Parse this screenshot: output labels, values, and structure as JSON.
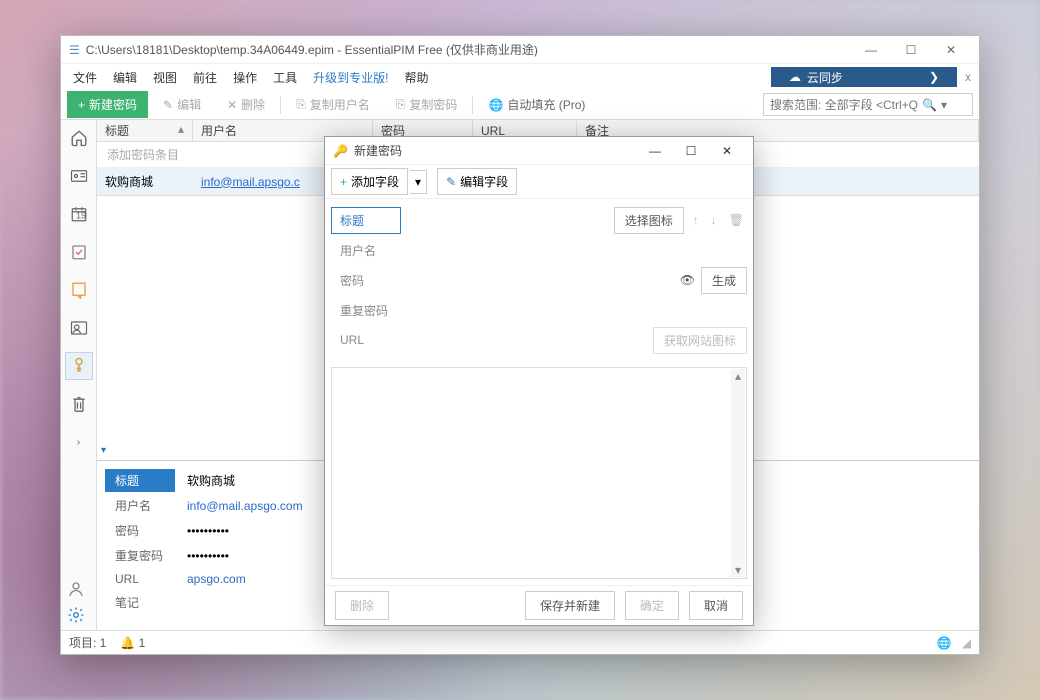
{
  "window": {
    "title": "C:\\Users\\18181\\Desktop\\temp.34A06449.epim - EssentialPIM Free (仅供非商业用途)"
  },
  "menu": {
    "file": "文件",
    "edit": "编辑",
    "view": "视图",
    "goto": "前往",
    "action": "操作",
    "tool": "工具",
    "upgrade": "升级到专业版!",
    "help": "帮助",
    "cloud": "云同步"
  },
  "toolbar": {
    "new": "新建密码",
    "edit": "编辑",
    "del": "删除",
    "copyuser": "复制用户名",
    "copypwd": "复制密码",
    "autofill": "自动填充 (Pro)",
    "search": "搜索范围: 全部字段  <Ctrl+Q"
  },
  "grid": {
    "cols": {
      "title": "标题",
      "user": "用户名",
      "pwd": "密码",
      "url": "URL",
      "note": "备注"
    },
    "addrow": "添加密码条目",
    "row": {
      "title": "软购商城",
      "user": "info@mail.apsgo.c"
    }
  },
  "detail": {
    "labels": {
      "title": "标题",
      "user": "用户名",
      "pwd": "密码",
      "rpwd": "重复密码",
      "url": "URL",
      "note": "笔记"
    },
    "vals": {
      "title": "软购商城",
      "user": "info@mail.apsgo.com",
      "pwd": "••••••••••",
      "rpwd": "••••••••••",
      "url": "apsgo.com"
    }
  },
  "status": {
    "items": "项目: 1",
    "bell": "1"
  },
  "modal": {
    "title": "新建密码",
    "addfield": "添加字段",
    "editfield": "编辑字段",
    "labels": {
      "title": "标题",
      "user": "用户名",
      "pwd": "密码",
      "rpwd": "重复密码",
      "url": "URL"
    },
    "buttons": {
      "selicon": "选择图标",
      "gen": "生成",
      "geticon": "获取网站图标",
      "del": "删除",
      "savenew": "保存并新建",
      "ok": "确定",
      "cancel": "取消"
    }
  }
}
